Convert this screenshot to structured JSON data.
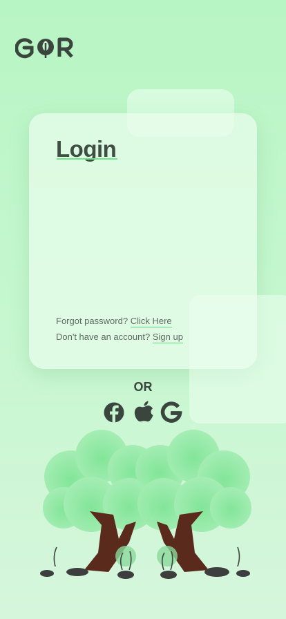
{
  "brand": {
    "logo_text": "GOR"
  },
  "login": {
    "title": "Login",
    "forgot_prefix": "Forgot password?",
    "forgot_link": "Click Here",
    "signup_prefix": "Don't have an account?",
    "signup_link": "Sign up"
  },
  "divider": {
    "label": "OR"
  },
  "social": [
    "facebook-icon",
    "apple-icon",
    "google-icon"
  ],
  "colors": {
    "accent": "#6fe587",
    "text_dark": "#3f4d43",
    "background": "#b8f5c4"
  }
}
